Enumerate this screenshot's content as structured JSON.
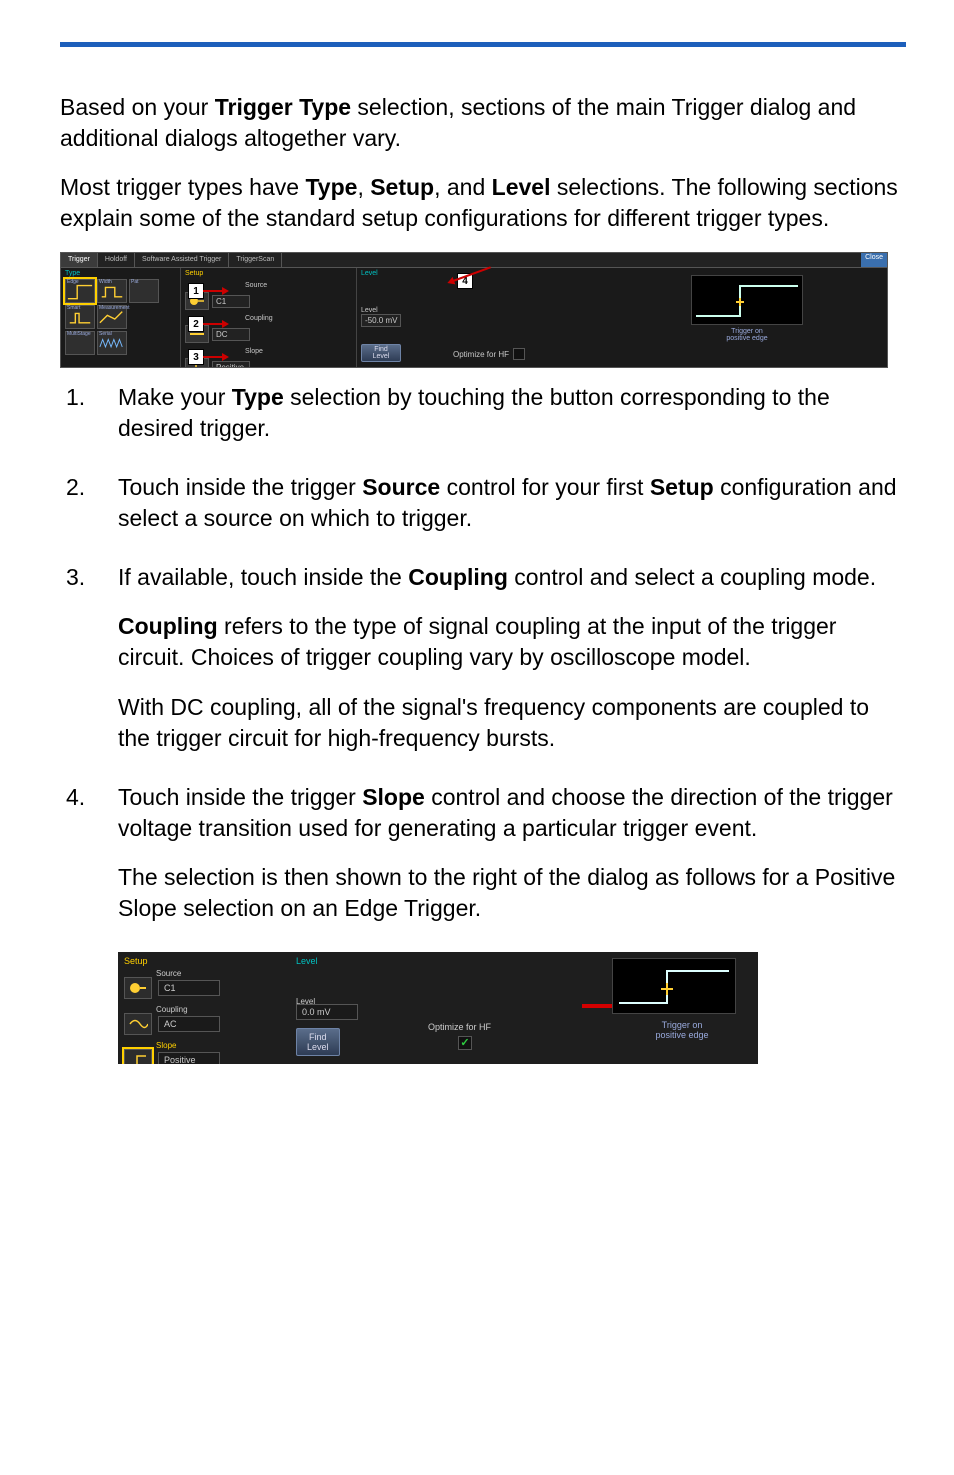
{
  "intro": {
    "p1_a": "Based on your ",
    "p1_b": "Trigger Type",
    "p1_c": " selection, sections of the main Trigger dialog and additional dialogs altogether vary.",
    "p2_a": "Most trigger types have ",
    "p2_b": "Type",
    "p2_c": ", ",
    "p2_d": "Setup",
    "p2_e": ", and ",
    "p2_f": "Level",
    "p2_g": " selections. The following sections explain some of the standard setup configurations for different trigger types."
  },
  "shot1": {
    "tabs": [
      "Trigger",
      "Holdoff",
      "Software Assisted Trigger",
      "TriggerScan"
    ],
    "close": "Close",
    "type_hdr": "Type",
    "type_labels": [
      "Edge",
      "Width",
      "Pat",
      "Smart",
      "Measurement",
      "",
      "MultiStage",
      "Serial",
      ""
    ],
    "setup_hdr": "Setup",
    "source_lbl": "Source",
    "source_val": "C1",
    "coupling_lbl": "Coupling",
    "coupling_val": "DC",
    "slope_lbl": "Slope",
    "slope_val": "Positive",
    "level_hdr": "Level",
    "level_lbl": "Level",
    "level_val": "-50.0 mV",
    "find_btn": "Find\nLevel",
    "optim_lbl": "Optimize for HF",
    "status1": "Trigger on",
    "status2": "positive edge",
    "callouts": [
      "1",
      "2",
      "3",
      "4"
    ]
  },
  "steps": {
    "s1_a": "Make your ",
    "s1_b": "Type",
    "s1_c": " selection by touching the button corresponding to the desired trigger.",
    "s2_a": "Touch inside the trigger ",
    "s2_b": "Source",
    "s2_c": " control for your first ",
    "s2_d": "Setup",
    "s2_e": " configuration and select a source on which to trigger.",
    "s3_a": "If available, touch inside the ",
    "s3_b": "Coupling",
    "s3_c": " control and select a coupling mode.",
    "s3_p2_a": "Coupling",
    "s3_p2_b": " refers to the type of signal coupling at the input of the trigger circuit. Choices of trigger coupling vary by oscilloscope model.",
    "s3_p3": "With DC coupling, all of the signal's frequency components are coupled to the trigger circuit for high-frequency bursts.",
    "s4_a": "Touch inside the trigger ",
    "s4_b": "Slope",
    "s4_c": " control and choose the direction of the trigger voltage transition used for generating a particular trigger event.",
    "s4_p2": "The selection is then shown to the right of the dialog as follows for a Positive Slope selection on an Edge Trigger."
  },
  "shot2": {
    "setup_hdr": "Setup",
    "source_lbl": "Source",
    "source_val": "C1",
    "coupling_lbl": "Coupling",
    "coupling_val": "AC",
    "slope_lbl": "Slope",
    "slope_val": "Positive",
    "level_hdr": "Level",
    "level_lbl": "Level",
    "level_val": "0.0 mV",
    "find_btn": "Find\nLevel",
    "optim_lbl": "Optimize for HF",
    "status1": "Trigger on",
    "status2": "positive edge"
  }
}
